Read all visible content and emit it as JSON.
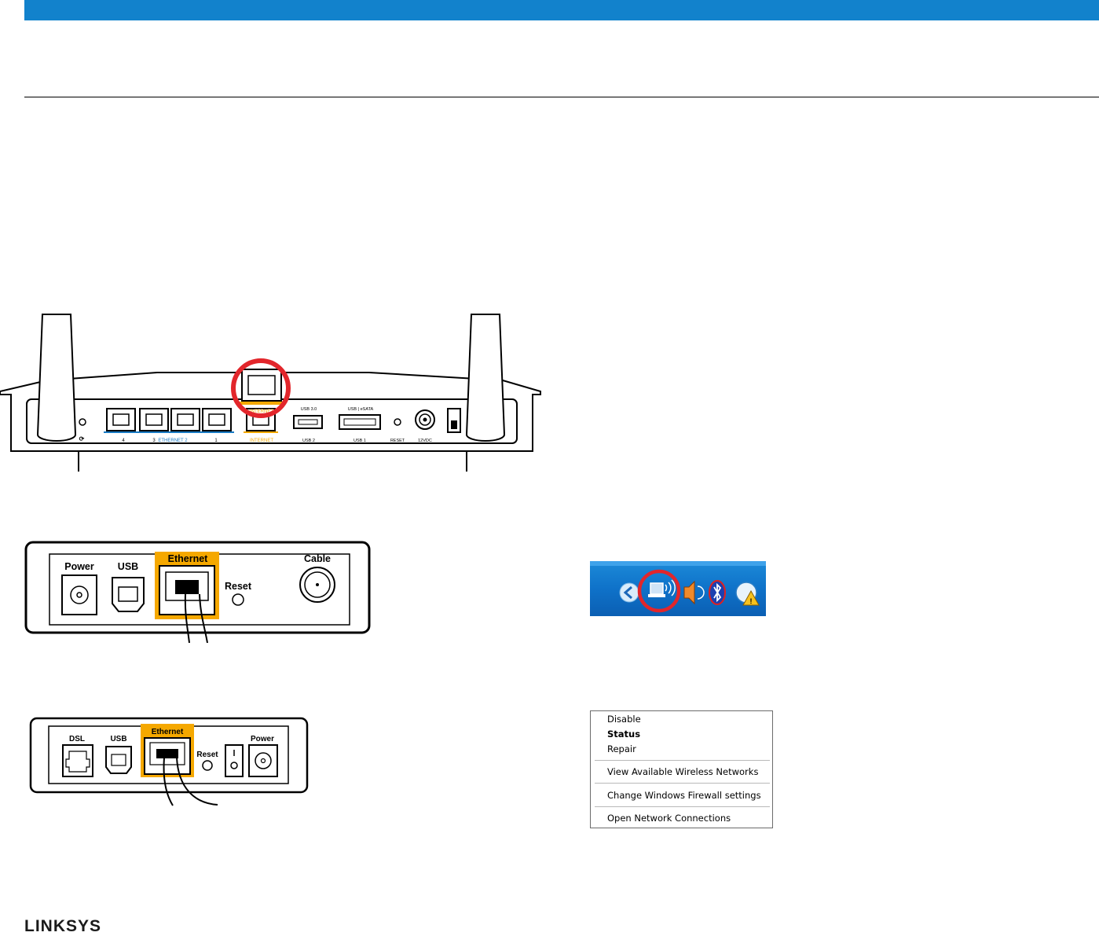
{
  "brand": {
    "logo_text": "LINKSYS",
    "bar_color": "#1282cc"
  },
  "router": {
    "port_labels": {
      "eth4": "4",
      "eth3": "3",
      "ethernet_group": "ETHERNET 2",
      "eth1": "1",
      "internet_top": "INTERNET",
      "internet_bottom": "INTERNET",
      "usb3_top": "USB 3.0",
      "usb2": "USB 2",
      "esata_top": "USB | eSATA",
      "usb1": "USB 1",
      "reset": "RESET",
      "power": "12VDC"
    },
    "highlight_color": "#e2262b",
    "internet_color": "#f5a800",
    "ethernet_color": "#1a7bc4"
  },
  "cable_modem": {
    "power": "Power",
    "usb": "USB",
    "ethernet": "Ethernet",
    "reset": "Reset",
    "cable": "Cable"
  },
  "dsl_modem": {
    "dsl": "DSL",
    "usb": "USB",
    "ethernet": "Ethernet",
    "reset": "Reset",
    "power": "Power"
  },
  "taskbar": {
    "icons": [
      "back-arrow-icon",
      "wireless-network-icon",
      "speaker-icon",
      "bluetooth-icon",
      "network-warning-icon"
    ]
  },
  "context_menu": {
    "disable": "Disable",
    "status": "Status",
    "repair": "Repair",
    "view_wireless": "View Available Wireless Networks",
    "firewall": "Change Windows Firewall settings",
    "open_connections": "Open Network Connections"
  }
}
